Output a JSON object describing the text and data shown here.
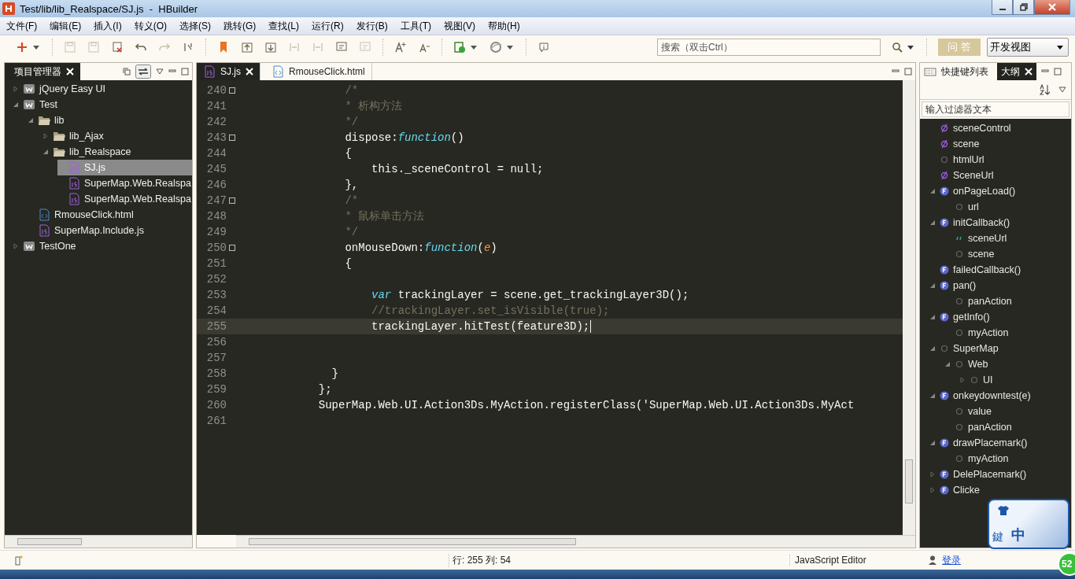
{
  "window": {
    "title": "Test/lib/lib_Realspace/SJ.js  -  HBuilder"
  },
  "menu": [
    "文件(F)",
    "编辑(E)",
    "插入(I)",
    "转义(O)",
    "选择(S)",
    "跳转(G)",
    "查找(L)",
    "运行(R)",
    "发行(B)",
    "工具(T)",
    "视图(V)",
    "帮助(H)"
  ],
  "toolbar": [
    {
      "kind": "new",
      "disabled": false
    },
    {
      "kind": "save",
      "disabled": true
    },
    {
      "kind": "save-all",
      "disabled": true
    },
    {
      "kind": "close-file",
      "disabled": false
    },
    {
      "kind": "undo",
      "disabled": false
    },
    {
      "kind": "redo",
      "disabled": true
    },
    {
      "kind": "format",
      "disabled": false
    },
    {
      "kind": "bookmark",
      "disabled": false
    },
    {
      "kind": "prev",
      "disabled": false
    },
    {
      "kind": "next",
      "disabled": false
    },
    {
      "kind": "indent-left",
      "disabled": true
    },
    {
      "kind": "indent-right",
      "disabled": true
    },
    {
      "kind": "wrap",
      "disabled": false
    },
    {
      "kind": "unwrap",
      "disabled": true
    },
    {
      "kind": "font-up",
      "disabled": false
    },
    {
      "kind": "font-down",
      "disabled": false
    },
    {
      "kind": "run",
      "disabled": false
    },
    {
      "kind": "browser",
      "disabled": false
    },
    {
      "kind": "info",
      "disabled": false
    }
  ],
  "search": {
    "placeholder": "搜索（双击Ctrl）"
  },
  "qa_button": "问 答",
  "perspective": {
    "value": "开发视图"
  },
  "project_panel": {
    "tab": {
      "label": "项目管理器",
      "selected": true
    },
    "tree": [
      {
        "label": "jQuery Easy UI",
        "kind": "project",
        "expanded": false,
        "selected": false
      },
      {
        "label": "Test",
        "kind": "project",
        "expanded": true,
        "selected": false,
        "children": [
          {
            "label": "lib",
            "kind": "folder",
            "expanded": true,
            "selected": false,
            "children": [
              {
                "label": "lib_Ajax",
                "kind": "folder",
                "expanded": false,
                "selected": false
              },
              {
                "label": "lib_Realspace",
                "kind": "folder",
                "expanded": true,
                "selected": false,
                "children": [
                  {
                    "label": "SJ.js",
                    "kind": "js",
                    "selected": true
                  },
                  {
                    "label": "SuperMap.Web.Realspa",
                    "kind": "js",
                    "selected": false
                  },
                  {
                    "label": "SuperMap.Web.Realspa",
                    "kind": "js",
                    "selected": false
                  }
                ]
              }
            ]
          },
          {
            "label": "RmouseClick.html",
            "kind": "html",
            "selected": false
          },
          {
            "label": "SuperMap.Include.js",
            "kind": "js",
            "selected": false
          }
        ]
      },
      {
        "label": "TestOne",
        "kind": "project",
        "expanded": false,
        "selected": false
      }
    ]
  },
  "editor": {
    "tabs": [
      {
        "label": "SJ.js",
        "kind": "js",
        "selected": true
      },
      {
        "label": "RmouseClick.html",
        "kind": "html",
        "selected": false
      }
    ],
    "lines": [
      {
        "num": "240",
        "fold": true,
        "current": false,
        "tokens": [
          {
            "kind": "comment",
            "text": "                /*"
          }
        ]
      },
      {
        "num": "241",
        "fold": false,
        "current": false,
        "tokens": [
          {
            "kind": "comment",
            "text": "                * 析构方法"
          }
        ]
      },
      {
        "num": "242",
        "fold": false,
        "current": false,
        "tokens": [
          {
            "kind": "comment",
            "text": "                */"
          }
        ]
      },
      {
        "num": "243",
        "fold": true,
        "current": false,
        "tokens": [
          {
            "kind": "plain",
            "text": "                dispose:"
          },
          {
            "kind": "keyword",
            "text": "function"
          },
          {
            "kind": "plain",
            "text": "()"
          }
        ]
      },
      {
        "num": "244",
        "fold": false,
        "current": false,
        "tokens": [
          {
            "kind": "plain",
            "text": "                {"
          }
        ]
      },
      {
        "num": "245",
        "fold": false,
        "current": false,
        "tokens": [
          {
            "kind": "plain",
            "text": "                    this._sceneControl = null;"
          }
        ]
      },
      {
        "num": "246",
        "fold": false,
        "current": false,
        "tokens": [
          {
            "kind": "plain",
            "text": "                },"
          }
        ]
      },
      {
        "num": "247",
        "fold": true,
        "current": false,
        "tokens": [
          {
            "kind": "comment",
            "text": "                /*"
          }
        ]
      },
      {
        "num": "248",
        "fold": false,
        "current": false,
        "tokens": [
          {
            "kind": "comment",
            "text": "                * 鼠标单击方法"
          }
        ]
      },
      {
        "num": "249",
        "fold": false,
        "current": false,
        "tokens": [
          {
            "kind": "comment",
            "text": "                */"
          }
        ]
      },
      {
        "num": "250",
        "fold": true,
        "current": false,
        "tokens": [
          {
            "kind": "plain",
            "text": "                onMouseDown:"
          },
          {
            "kind": "keyword",
            "text": "function"
          },
          {
            "kind": "plain",
            "text": "("
          },
          {
            "kind": "param",
            "text": "e"
          },
          {
            "kind": "plain",
            "text": ")"
          }
        ]
      },
      {
        "num": "251",
        "fold": false,
        "current": false,
        "tokens": [
          {
            "kind": "plain",
            "text": "                {"
          }
        ]
      },
      {
        "num": "252",
        "fold": false,
        "current": false
      },
      {
        "num": "253",
        "fold": false,
        "current": false,
        "tokens": [
          {
            "kind": "keyword",
            "text": "                    var"
          },
          {
            "kind": "plain",
            "text": " trackingLayer = scene.get_trackingLayer3D();"
          }
        ]
      },
      {
        "num": "254",
        "fold": false,
        "current": false,
        "tokens": [
          {
            "kind": "comment",
            "text": "                    //trackingLayer.set_isVisible(true);"
          }
        ]
      },
      {
        "num": "255",
        "fold": false,
        "current": true,
        "tokens": [
          {
            "kind": "plain",
            "text": "                    trackingLayer.hitTest(feature3D);"
          }
        ]
      },
      {
        "num": "256",
        "fold": false,
        "current": false
      },
      {
        "num": "257",
        "fold": false,
        "current": false
      },
      {
        "num": "258",
        "fold": false,
        "current": false,
        "tokens": [
          {
            "kind": "plain",
            "text": "              }"
          }
        ]
      },
      {
        "num": "259",
        "fold": false,
        "current": false,
        "tokens": [
          {
            "kind": "plain",
            "text": "            };"
          }
        ]
      },
      {
        "num": "260",
        "fold": false,
        "current": false,
        "tokens": [
          {
            "kind": "plain",
            "text": "            SuperMap.Web.UI.Action3Ds.MyAction.registerClass('SuperMap.Web.UI.Action3Ds.MyAct"
          }
        ]
      },
      {
        "num": "261",
        "fold": false,
        "current": false
      }
    ]
  },
  "outline_panel": {
    "tabs": [
      {
        "label": "快捷键列表",
        "selected": false
      },
      {
        "label": "大纲",
        "selected": true
      }
    ],
    "filter": {
      "placeholder": "输入过滤器文本"
    },
    "tree": [
      {
        "label": "sceneControl",
        "kind": "field"
      },
      {
        "label": "scene",
        "kind": "field"
      },
      {
        "label": "htmlUrl",
        "kind": "var"
      },
      {
        "label": "SceneUrl",
        "kind": "field"
      },
      {
        "label": "onPageLoad()",
        "kind": "function",
        "expanded": true,
        "children": [
          {
            "label": "url",
            "kind": "var"
          }
        ]
      },
      {
        "label": "initCallback()",
        "kind": "function",
        "expanded": true,
        "children": [
          {
            "label": "sceneUrl",
            "kind": "string"
          },
          {
            "label": "scene",
            "kind": "var"
          }
        ]
      },
      {
        "label": "failedCallback()",
        "kind": "function"
      },
      {
        "label": "pan()",
        "kind": "function",
        "expanded": true,
        "children": [
          {
            "label": "panAction",
            "kind": "var"
          }
        ]
      },
      {
        "label": "getInfo()",
        "kind": "function",
        "expanded": true,
        "children": [
          {
            "label": "myAction",
            "kind": "var"
          }
        ]
      },
      {
        "label": "SuperMap",
        "kind": "var",
        "expanded": true,
        "children": [
          {
            "label": "Web",
            "kind": "var",
            "expanded": true,
            "children": [
              {
                "label": "UI",
                "kind": "var",
                "expanded": false
              }
            ]
          }
        ]
      },
      {
        "label": "onkeydowntest(e)",
        "kind": "function",
        "expanded": true,
        "children": [
          {
            "label": "value",
            "kind": "var"
          },
          {
            "label": "panAction",
            "kind": "var"
          }
        ]
      },
      {
        "label": "drawPlacemark()",
        "kind": "function",
        "expanded": true,
        "children": [
          {
            "label": "myAction",
            "kind": "var"
          }
        ]
      },
      {
        "label": "DelePlacemark()",
        "kind": "function",
        "expanded": false
      },
      {
        "label": "Clicke",
        "kind": "function",
        "expanded": false
      }
    ]
  },
  "ime_widget": {
    "labels": [
      "鍵",
      "中"
    ]
  },
  "status_bar": {
    "position": "行: 255 列: 54",
    "editor_type": "JavaScript Editor",
    "login_link": "登录"
  },
  "notification_badge": "52"
}
